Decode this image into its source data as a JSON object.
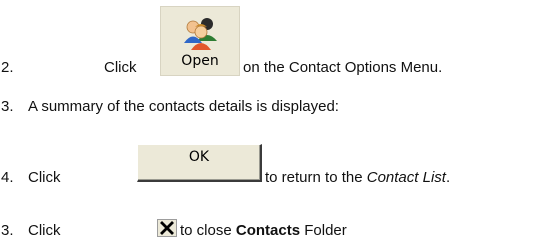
{
  "steps": [
    {
      "number": "2.",
      "before": "Click",
      "after": "on the Contact Options Menu."
    },
    {
      "number": "3.",
      "text": "A summary of the contacts details is displayed:"
    },
    {
      "number": "4.",
      "before": "Click",
      "after_pre": "to return to the ",
      "after_italic": "Contact List",
      "after_post": "."
    },
    {
      "number": "3.",
      "before": "Click",
      "after_pre": "to close ",
      "after_bold": "Contacts",
      "after_post": " Folder"
    }
  ],
  "open_button": {
    "label": "Open",
    "icon": "contacts-icon"
  },
  "ok_button": {
    "label": "OK"
  },
  "close_button": {
    "icon": "close-icon"
  }
}
